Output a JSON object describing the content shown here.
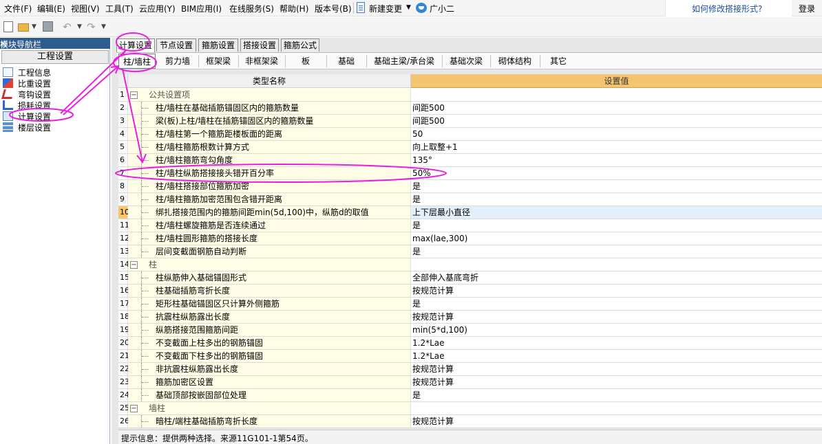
{
  "menubar": {
    "items": [
      "文件(F)",
      "编辑(E)",
      "视图(V)",
      "工具(T)",
      "云应用(Y)",
      "BIM应用(I)",
      "在线服务(S)",
      "帮助(H)",
      "版本号(B)"
    ],
    "new_change": "新建变更",
    "guangxiaoer": "广小二",
    "help_question": "如何修改搭接形式?",
    "login": "登录"
  },
  "nav": {
    "title": "模块导航栏",
    "pin": "ㅁ",
    "close": "×",
    "section": "工程设置",
    "items": [
      "工程信息",
      "比重设置",
      "弯钩设置",
      "损耗设置",
      "计算设置",
      "楼层设置"
    ],
    "icons": [
      "doc-icon",
      "scale-icon",
      "hook-icon",
      "loss-icon",
      "calc-icon",
      "floor-icon"
    ]
  },
  "tabs": [
    "计算设置",
    "节点设置",
    "箍筋设置",
    "搭接设置",
    "箍筋公式"
  ],
  "active_tab": "计算设置",
  "subtabs": [
    "柱/墙柱",
    "剪力墙",
    "框架梁",
    "非框架梁",
    "板",
    "基础",
    "基础主梁/承台梁",
    "基础次梁",
    "砌体结构",
    "其它"
  ],
  "active_subtab": "柱/墙柱",
  "grid": {
    "col_name": "类型名称",
    "col_value": "设置值",
    "rows": [
      {
        "n": "1",
        "name": "公共设置项",
        "val": "",
        "group": true
      },
      {
        "n": "2",
        "name": "柱/墙柱在基础插筋锚固区内的箍筋数量",
        "val": "间距500"
      },
      {
        "n": "3",
        "name": "梁(板)上柱/墙柱在插筋锚固区内的箍筋数量",
        "val": "间距500"
      },
      {
        "n": "4",
        "name": "柱/墙柱第一个箍筋距楼板面的距离",
        "val": "50"
      },
      {
        "n": "5",
        "name": "柱/墙柱箍筋根数计算方式",
        "val": "向上取整+1"
      },
      {
        "n": "6",
        "name": "柱/墙柱箍筋弯勾角度",
        "val": "135°"
      },
      {
        "n": "7",
        "name": "柱/墙柱纵筋搭接接头错开百分率",
        "val": "50%"
      },
      {
        "n": "8",
        "name": "柱/墙柱搭接部位箍筋加密",
        "val": "是"
      },
      {
        "n": "9",
        "name": "柱/墙柱箍筋加密范围包含错开距离",
        "val": "是"
      },
      {
        "n": "10",
        "name": "绑扎搭接范围内的箍筋间距min(5d,100)中，纵筋d的取值",
        "val": "上下层最小直径",
        "selected": true
      },
      {
        "n": "11",
        "name": "柱/墙柱螺旋箍筋是否连续通过",
        "val": "是"
      },
      {
        "n": "12",
        "name": "柱/墙柱圆形箍筋的搭接长度",
        "val": "max(lae,300)"
      },
      {
        "n": "13",
        "name": "层间变截面钢筋自动判断",
        "val": "是"
      },
      {
        "n": "14",
        "name": "柱",
        "val": "",
        "group": true
      },
      {
        "n": "15",
        "name": "柱纵筋伸入基础锚固形式",
        "val": "全部伸入基底弯折"
      },
      {
        "n": "16",
        "name": "柱基础插筋弯折长度",
        "val": "按规范计算"
      },
      {
        "n": "17",
        "name": "矩形柱基础锚固区只计算外侧箍筋",
        "val": "是"
      },
      {
        "n": "18",
        "name": "抗震柱纵筋露出长度",
        "val": "按规范计算"
      },
      {
        "n": "19",
        "name": "纵筋搭接范围箍筋间距",
        "val": "min(5*d,100)"
      },
      {
        "n": "20",
        "name": "不变截面上柱多出的钢筋锚固",
        "val": "1.2*Lae"
      },
      {
        "n": "21",
        "name": "不变截面下柱多出的钢筋锚固",
        "val": "1.2*Lae"
      },
      {
        "n": "22",
        "name": "非抗震柱纵筋露出长度",
        "val": "按规范计算"
      },
      {
        "n": "23",
        "name": "箍筋加密区设置",
        "val": "按规范计算"
      },
      {
        "n": "24",
        "name": "基础顶部按嵌固部位处理",
        "val": "是"
      },
      {
        "n": "25",
        "name": "墙柱",
        "val": "",
        "group": true
      },
      {
        "n": "26",
        "name": "暗柱/端柱基础插筋弯折长度",
        "val": "按规范计算"
      }
    ]
  },
  "status": "提示信息：提供两种选择。来源11G101-1第54页。",
  "colors": {
    "header_value_bg": "#f3c571",
    "name_cell_bg": "#fffde6",
    "annotation": "#e81ee0",
    "nav_header": "#2f5c8f"
  }
}
